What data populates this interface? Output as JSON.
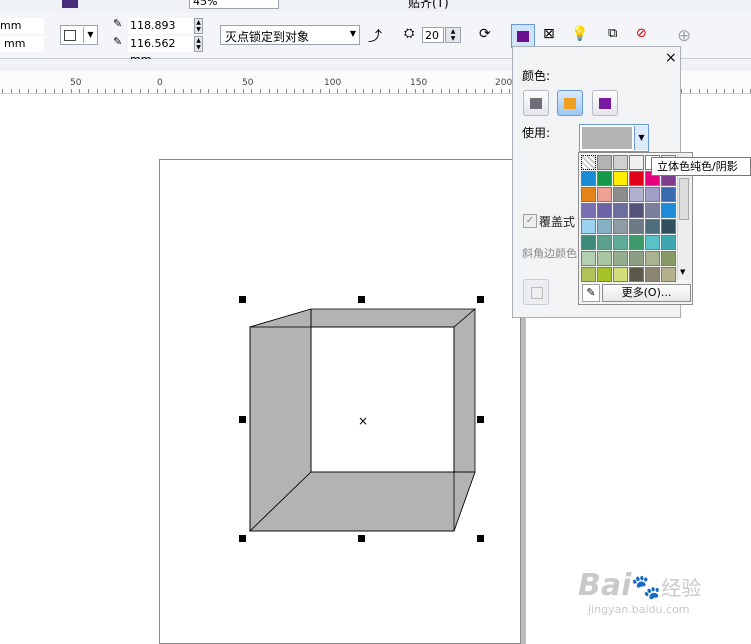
{
  "toolbar": {
    "zoom": "45%",
    "snap": "贴齐(T)",
    "size_w": "mm",
    "size_h": "mm",
    "vp_x": "118.893 mm",
    "vp_y": "116.562 mm",
    "vanishing_point": "灭点锁定到对象",
    "depth": "20"
  },
  "ruler": {
    "labels": [
      "50",
      "0",
      "50",
      "100",
      "150",
      "200"
    ]
  },
  "docker": {
    "color_label": "颜色:",
    "use_label": "使用:",
    "close": "×",
    "overprint_label": "覆盖式",
    "bevel_color_label": "斜角边颜色",
    "current_color": "#b3b3b3"
  },
  "palette": {
    "swatches": [
      [
        "none",
        "#b3b3b3",
        "#d0d0d0",
        "#f0f0f0",
        "#ffffff",
        "#e9e9e9"
      ],
      [
        "#1a8ad4",
        "#129a48",
        "#ffee00",
        "#e0001a",
        "#e6007e",
        "#7f3c8d"
      ],
      [
        "#e6841a",
        "#eda193",
        "#8d8d8d",
        "#b1b1d0",
        "#9f9fc9",
        "#3c6ab0"
      ],
      [
        "#7a6fb0",
        "#6c62a6",
        "#6c6f9d",
        "#55527a",
        "#7c7f9c",
        "#1f8ad6"
      ],
      [
        "#9ad3f0",
        "#86b0c6",
        "#8e9ca8",
        "#6d7a84",
        "#4e6e7c",
        "#2f4f5c"
      ],
      [
        "#3d8a7a",
        "#5aa08a",
        "#5fab9a",
        "#3c9a6b",
        "#57c2c8",
        "#3da7b0"
      ],
      [
        "#b3d0b0",
        "#a8c7a0",
        "#94ad8c",
        "#8c9e84",
        "#aab390",
        "#889b66"
      ],
      [
        "#b2c25a",
        "#a7c229",
        "#d3dd7a",
        "#5b5a48",
        "#8a8671",
        "#b4b08c"
      ]
    ],
    "more_button": "更多(O)...",
    "tooltip": "立体色纯色/阴影"
  },
  "watermark": {
    "brand": "Bai",
    "brand2": "经验",
    "url": "jingyan.baidu.com"
  }
}
